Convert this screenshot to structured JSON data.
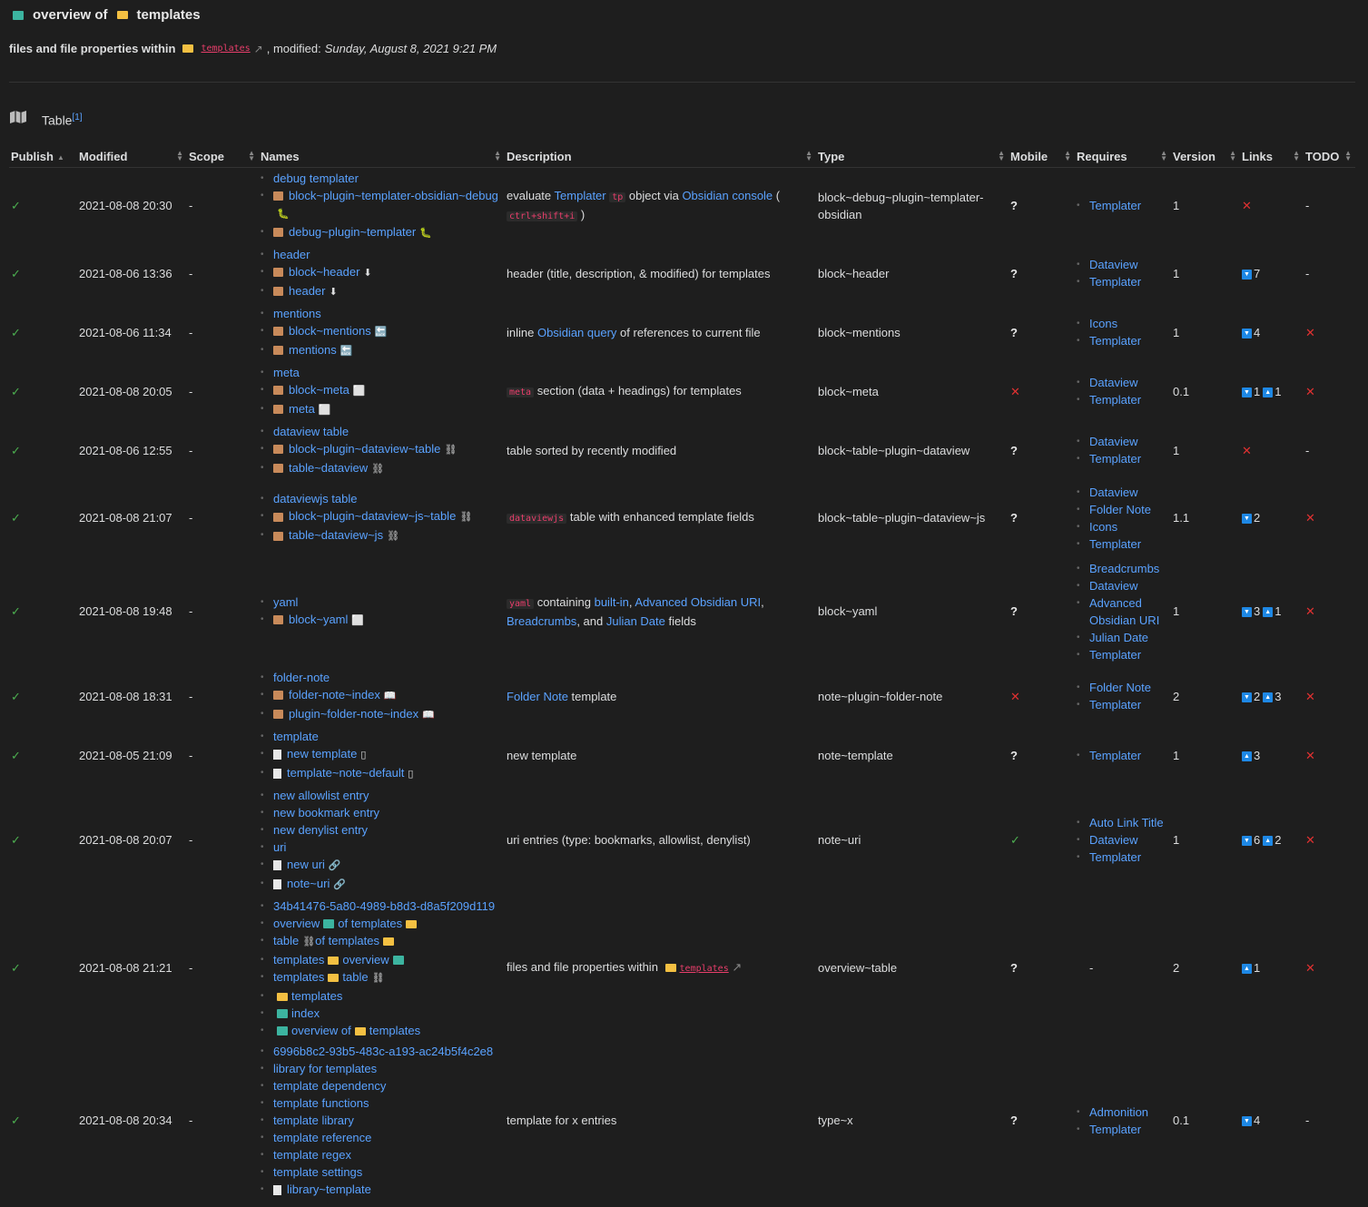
{
  "header": {
    "title_pre": "overview of",
    "title_folder": "templates",
    "sub_bold": "files and file properties within",
    "sub_link": "templates",
    "sub_modified_label": ", modified:",
    "sub_date": "Sunday, August 8, 2021 9:21 PM"
  },
  "section": {
    "label": "Table",
    "footnote": "[1]"
  },
  "columns": [
    "Publish",
    "Modified",
    "Scope",
    "Names",
    "Description",
    "Type",
    "Mobile",
    "Requires",
    "Version",
    "Links",
    "TODO"
  ],
  "rows": [
    {
      "modified": "2021-08-08 20:30",
      "scope": "-",
      "names": [
        {
          "t": "debug templater",
          "ic": ""
        },
        {
          "t": "block~plugin~templater-obsidian~debug",
          "ic": "box",
          "after": "🐛"
        },
        {
          "t": "debug~plugin~templater",
          "ic": "box",
          "after": "🐛"
        }
      ],
      "desc_parts": [
        {
          "t": "evaluate "
        },
        {
          "t": "Templater",
          "l": 1
        },
        {
          "t": " "
        },
        {
          "t": "tp",
          "c": 1
        },
        {
          "t": " object via "
        },
        {
          "t": "Obsidian console",
          "l": 1
        },
        {
          "t": " ( "
        },
        {
          "t": "ctrl+shift+i",
          "c": 1
        },
        {
          "t": " )"
        }
      ],
      "type": "block~debug~plugin~templater-obsidian",
      "mobile": "?",
      "requires": [
        "Templater"
      ],
      "version": "1",
      "links": {
        "x": true
      },
      "todo": "-"
    },
    {
      "modified": "2021-08-06 13:36",
      "scope": "-",
      "names": [
        {
          "t": "header",
          "ic": ""
        },
        {
          "t": "block~header",
          "ic": "box",
          "after": "⬇"
        },
        {
          "t": "header",
          "ic": "box",
          "after": "⬇"
        }
      ],
      "desc_parts": [
        {
          "t": "header (title, description, & modified) for templates"
        }
      ],
      "type": "block~header",
      "mobile": "?",
      "requires": [
        "Dataview",
        "Templater"
      ],
      "version": "1",
      "links": {
        "down": "7"
      },
      "todo": "-"
    },
    {
      "modified": "2021-08-06 11:34",
      "scope": "-",
      "names": [
        {
          "t": "mentions",
          "ic": ""
        },
        {
          "t": "block~mentions",
          "ic": "box",
          "after": "🔙"
        },
        {
          "t": "mentions",
          "ic": "box",
          "after": "🔙"
        }
      ],
      "desc_parts": [
        {
          "t": "inline "
        },
        {
          "t": "Obsidian query",
          "l": 1
        },
        {
          "t": " of references to current file"
        }
      ],
      "type": "block~mentions",
      "mobile": "?",
      "requires": [
        "Icons",
        "Templater"
      ],
      "version": "1",
      "links": {
        "down": "4"
      },
      "todo": "x"
    },
    {
      "modified": "2021-08-08 20:05",
      "scope": "-",
      "names": [
        {
          "t": "meta",
          "ic": ""
        },
        {
          "t": "block~meta",
          "ic": "box",
          "after": "⬜"
        },
        {
          "t": "meta",
          "ic": "box",
          "after": "⬜"
        }
      ],
      "desc_parts": [
        {
          "t": "meta",
          "c": 1
        },
        {
          "t": " section (data + headings) for templates"
        }
      ],
      "type": "block~meta",
      "mobile": "x",
      "requires": [
        "Dataview",
        "Templater"
      ],
      "version": "0.1",
      "links": {
        "down": "1",
        "up": "1"
      },
      "todo": "x"
    },
    {
      "modified": "2021-08-06 12:55",
      "scope": "-",
      "names": [
        {
          "t": "dataview table",
          "ic": ""
        },
        {
          "t": "block~plugin~dataview~table",
          "ic": "box",
          "after": "⛓"
        },
        {
          "t": "table~dataview",
          "ic": "box",
          "after": "⛓"
        }
      ],
      "desc_parts": [
        {
          "t": "table sorted by recently modified"
        }
      ],
      "type": "block~table~plugin~dataview",
      "mobile": "?",
      "requires": [
        "Dataview",
        "Templater"
      ],
      "version": "1",
      "links": {
        "x": true
      },
      "todo": "-"
    },
    {
      "modified": "2021-08-08 21:07",
      "scope": "-",
      "names": [
        {
          "t": "dataviewjs table",
          "ic": ""
        },
        {
          "t": "block~plugin~dataview~js~table",
          "ic": "box",
          "after": "⛓"
        },
        {
          "t": "table~dataview~js",
          "ic": "box",
          "after": "⛓"
        }
      ],
      "desc_parts": [
        {
          "t": "dataviewjs",
          "c": 1
        },
        {
          "t": " table with enhanced template fields"
        }
      ],
      "type": "block~table~plugin~dataview~js",
      "mobile": "?",
      "requires": [
        "Dataview",
        "Folder Note",
        "Icons",
        "Templater"
      ],
      "version": "1.1",
      "links": {
        "down": "2"
      },
      "todo": "x"
    },
    {
      "modified": "2021-08-08 19:48",
      "scope": "-",
      "names": [
        {
          "t": "yaml",
          "ic": ""
        },
        {
          "t": "block~yaml",
          "ic": "box",
          "after": "⬜"
        }
      ],
      "desc_parts": [
        {
          "t": "yaml",
          "c": 1
        },
        {
          "t": " containing "
        },
        {
          "t": "built-in",
          "l": 1
        },
        {
          "t": ", "
        },
        {
          "t": "Advanced Obsidian URI",
          "l": 1
        },
        {
          "t": ", "
        },
        {
          "t": "Breadcrumbs",
          "l": 1
        },
        {
          "t": ", and "
        },
        {
          "t": "Julian Date",
          "l": 1
        },
        {
          "t": " fields"
        }
      ],
      "type": "block~yaml",
      "mobile": "?",
      "requires": [
        "Breadcrumbs",
        "Dataview",
        "Advanced Obsidian URI",
        "Julian Date",
        "Templater"
      ],
      "version": "1",
      "links": {
        "down": "3",
        "up": "1"
      },
      "todo": "x"
    },
    {
      "modified": "2021-08-08 18:31",
      "scope": "-",
      "names": [
        {
          "t": "folder-note",
          "ic": ""
        },
        {
          "t": "folder-note~index",
          "ic": "box",
          "after": "📖"
        },
        {
          "t": "plugin~folder-note~index",
          "ic": "box",
          "after": "📖"
        }
      ],
      "desc_parts": [
        {
          "t": "Folder Note",
          "l": 1
        },
        {
          "t": " template"
        }
      ],
      "type": "note~plugin~folder-note",
      "mobile": "x",
      "requires": [
        "Folder Note",
        "Templater"
      ],
      "version": "2",
      "links": {
        "down": "2",
        "up": "3"
      },
      "todo": "x"
    },
    {
      "modified": "2021-08-05 21:09",
      "scope": "-",
      "names": [
        {
          "t": "template",
          "ic": ""
        },
        {
          "t": "new template",
          "ic": "doc",
          "after": "▯"
        },
        {
          "t": "template~note~default",
          "ic": "doc",
          "after": "▯"
        }
      ],
      "desc_parts": [
        {
          "t": "new template"
        }
      ],
      "type": "note~template",
      "mobile": "?",
      "requires": [
        "Templater"
      ],
      "version": "1",
      "links": {
        "up": "3"
      },
      "todo": "x"
    },
    {
      "modified": "2021-08-08 20:07",
      "scope": "-",
      "names": [
        {
          "t": "new allowlist entry",
          "ic": ""
        },
        {
          "t": "new bookmark entry",
          "ic": ""
        },
        {
          "t": "new denylist entry",
          "ic": ""
        },
        {
          "t": "uri",
          "ic": ""
        },
        {
          "t": "new uri",
          "ic": "doc",
          "after": "🔗"
        },
        {
          "t": "note~uri",
          "ic": "doc",
          "after": "🔗"
        }
      ],
      "desc_parts": [
        {
          "t": "uri entries (type: bookmarks, allowlist, denylist)"
        }
      ],
      "type": "note~uri",
      "mobile": "chk",
      "requires": [
        "Auto Link Title",
        "Dataview",
        "Templater"
      ],
      "version": "1",
      "links": {
        "down": "6",
        "up": "2"
      },
      "todo": "x"
    },
    {
      "modified": "2021-08-08 21:21",
      "scope": "-",
      "names": [
        {
          "t": "34b41476-5a80-4989-b8d3-d8a5f209d119",
          "ic": ""
        },
        {
          "t": "overview",
          "ic": "",
          "mid": "book",
          "t2": "of templates",
          "end": "fold"
        },
        {
          "t": "table",
          "ic": "",
          "mid": "chain",
          "t2": "of templates",
          "end": "fold"
        },
        {
          "t": "templates",
          "ic": "",
          "mid": "fold",
          "t2": "overview",
          "end": "book"
        },
        {
          "t": "templates",
          "ic": "",
          "mid": "fold",
          "t2": "table",
          "end": "chain"
        },
        {
          "t": "templates",
          "ic": "fold"
        },
        {
          "t": "index",
          "ic": "book"
        },
        {
          "t": "overview of",
          "ic": "book",
          "mid": "fold",
          "t2": "templates"
        }
      ],
      "desc_parts": [
        {
          "t": "files and file properties within "
        },
        {
          "t": "templates",
          "cl": 1
        }
      ],
      "type": "overview~table",
      "mobile": "?",
      "requires": [],
      "requires_text": "-",
      "version": "2",
      "links": {
        "up": "1"
      },
      "todo": "x"
    },
    {
      "modified": "2021-08-08 20:34",
      "scope": "-",
      "names": [
        {
          "t": "6996b8c2-93b5-483c-a193-ac24b5f4c2e8",
          "ic": ""
        },
        {
          "t": "library for templates",
          "ic": ""
        },
        {
          "t": "template dependency",
          "ic": ""
        },
        {
          "t": "template functions",
          "ic": ""
        },
        {
          "t": "template library",
          "ic": ""
        },
        {
          "t": "template reference",
          "ic": ""
        },
        {
          "t": "template regex",
          "ic": ""
        },
        {
          "t": "template settings",
          "ic": ""
        },
        {
          "t": "library~template",
          "ic": "doc"
        }
      ],
      "desc_parts": [
        {
          "t": "template for x entries"
        }
      ],
      "type": "type~x",
      "mobile": "?",
      "requires": [
        "Admonition",
        "Templater"
      ],
      "version": "0.1",
      "links": {
        "down": "4"
      },
      "todo": "-"
    }
  ],
  "colors": {
    "link": "#5aa2ff",
    "check": "#4caf50",
    "cross": "#e03131",
    "badge": "#1e88e5",
    "code": "#e83e6b"
  }
}
